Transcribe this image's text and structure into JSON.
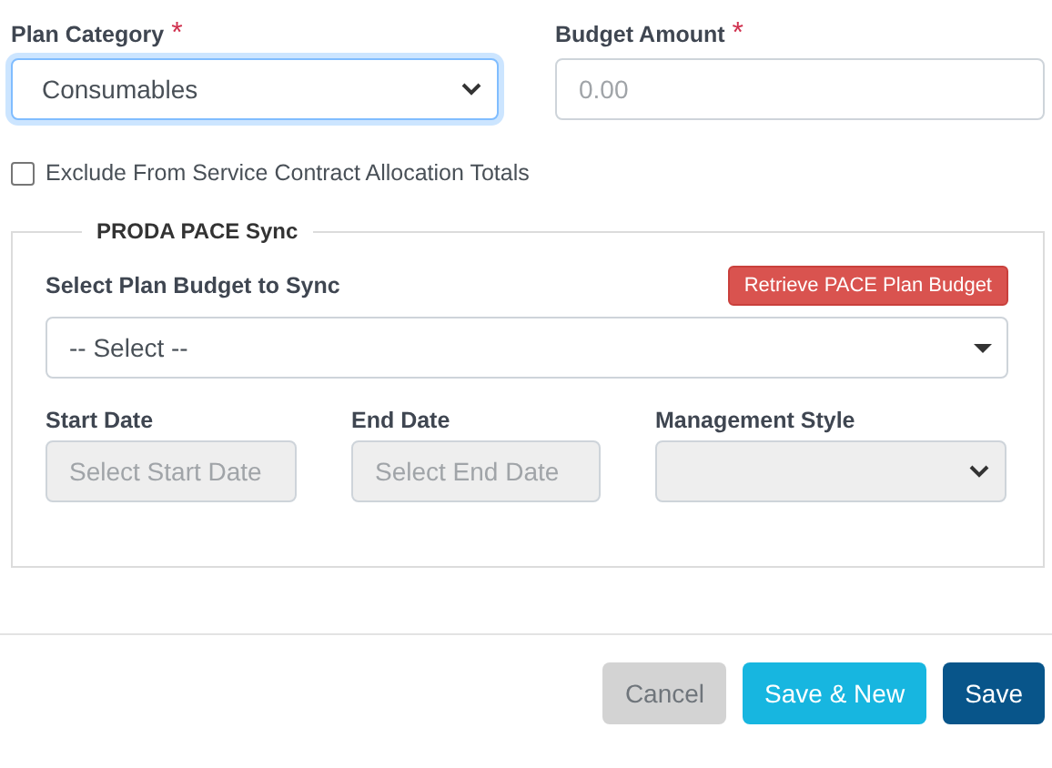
{
  "plan_category": {
    "label": "Plan Category",
    "required_mark": "*",
    "value": "Consumables",
    "focused": true
  },
  "budget_amount": {
    "label": "Budget Amount",
    "required_mark": "*",
    "placeholder": "0.00"
  },
  "exclude_checkbox": {
    "label": "Exclude From Service Contract Allocation Totals",
    "checked": false
  },
  "pace_sync": {
    "legend": "PRODA PACE Sync",
    "budget_label": "Select Plan Budget to Sync",
    "retrieve_button": "Retrieve PACE Plan Budget",
    "budget_select": {
      "value": "-- Select --"
    },
    "fields": [
      {
        "kind": "date",
        "label": "Start Date",
        "placeholder": "Select Start Date",
        "disabled": true
      },
      {
        "kind": "date",
        "label": "End Date",
        "placeholder": "Select End Date",
        "disabled": true
      },
      {
        "kind": "select",
        "label": "Management Style",
        "disabled": true
      }
    ]
  },
  "buttons": [
    {
      "kind": "secondary",
      "label": "Cancel",
      "disabled": true
    },
    {
      "kind": "info",
      "label": "Save & New",
      "disabled": false
    },
    {
      "kind": "primary",
      "label": "Save",
      "disabled": false
    }
  ]
}
